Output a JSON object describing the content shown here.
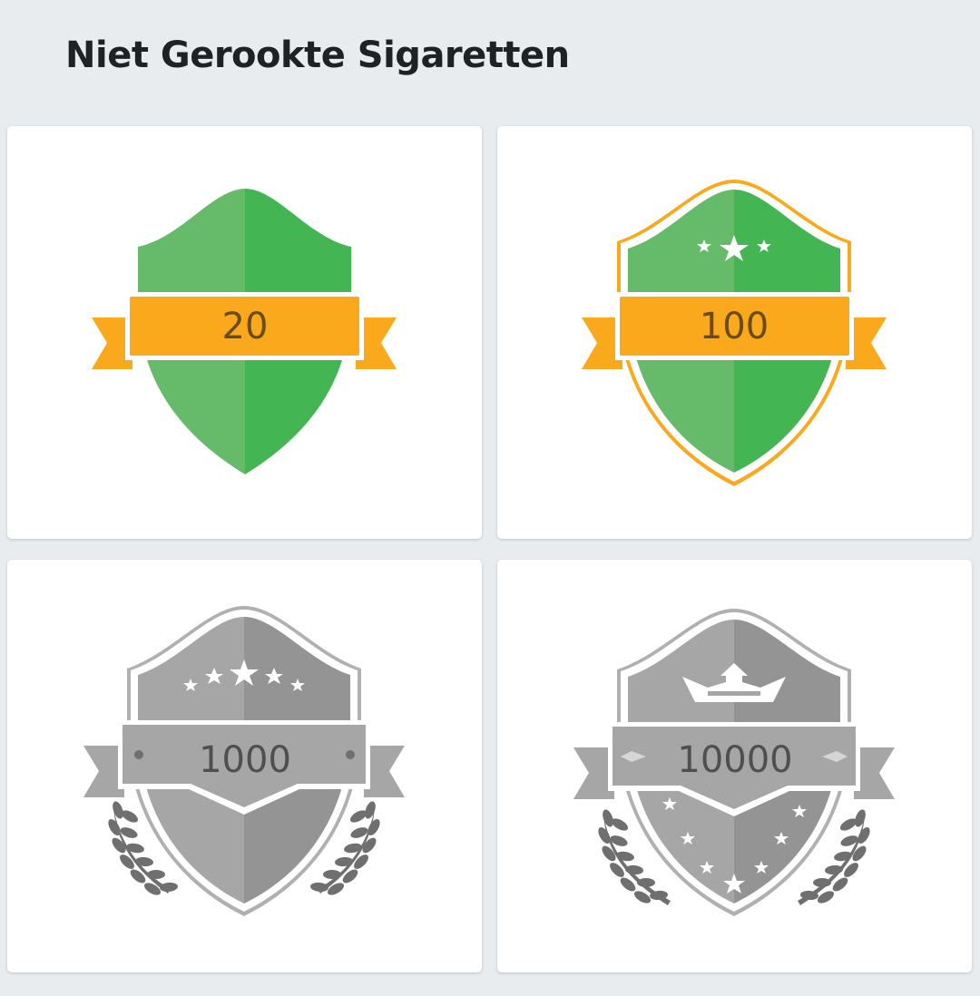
{
  "header": {
    "title": "Niet Gerookte Sigaretten"
  },
  "colors": {
    "background": "#e8ecee",
    "card": "#ffffff",
    "green_light": "#66bb6a",
    "green_dark": "#43b553",
    "orange": "#f9a91b",
    "orange_text": "#6b4a13",
    "grey_light": "#a6a6a6",
    "grey_dark": "#949494",
    "grey_text": "#4f4f4f"
  },
  "badges": [
    {
      "label": "20",
      "achieved": true,
      "icon": "shield-badge-icon"
    },
    {
      "label": "100",
      "achieved": true,
      "icon": "shield-stars-badge-icon"
    },
    {
      "label": "1000",
      "achieved": false,
      "icon": "shield-laurel-badge-icon"
    },
    {
      "label": "10000",
      "achieved": false,
      "icon": "shield-crown-badge-icon"
    }
  ]
}
